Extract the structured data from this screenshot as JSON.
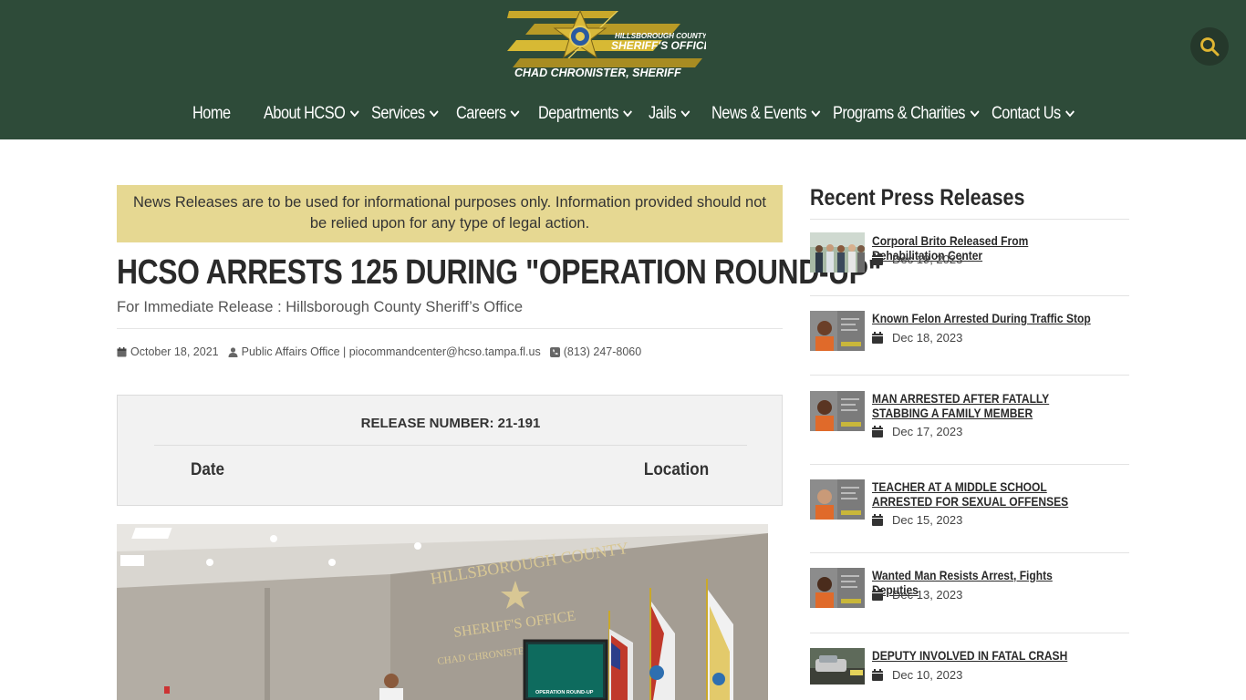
{
  "header": {
    "logo": {
      "line1": "HILLSBOROUGH COUNTY",
      "line2": "SHERIFF'S OFFICE",
      "line3": "CHAD CHRONISTER, SHERIFF"
    },
    "search_icon": "search-icon",
    "nav": [
      {
        "label": "Home",
        "has_dropdown": false
      },
      {
        "label": "About HCSO",
        "has_dropdown": true
      },
      {
        "label": "Services",
        "has_dropdown": true
      },
      {
        "label": "Careers",
        "has_dropdown": true
      },
      {
        "label": "Departments",
        "has_dropdown": true
      },
      {
        "label": "Jails",
        "has_dropdown": true
      },
      {
        "label": "News & Events",
        "has_dropdown": true
      },
      {
        "label": "Programs & Charities",
        "has_dropdown": true
      },
      {
        "label": "Contact Us",
        "has_dropdown": true
      }
    ]
  },
  "article": {
    "notice": "News Releases are to be used for informational purposes only. Information provided should not be relied upon for any type of legal action.",
    "title": "HCSO ARRESTS 125 DURING \"OPERATION ROUND-UP\"",
    "subtitle": "For Immediate Release : Hillsborough County Sheriff’s Office",
    "meta": {
      "date": "October 18, 2021",
      "author": "Public Affairs Office | piocommandcenter@hcso.tampa.fl.us",
      "phone": "(813) 247-8060"
    },
    "release_box": {
      "release_number": "RELEASE NUMBER: 21-191",
      "col_date": "Date",
      "col_location": "Location"
    },
    "photo": {
      "wall_line1": "HILLSBOROUGH COUNTY",
      "wall_line2": "SHERIFF'S OFFICE",
      "wall_line3": "CHAD CHRONISTER, SHERIFF",
      "screen_text": "OPERATION ROUND-UP"
    }
  },
  "sidebar": {
    "title": "Recent Press Releases",
    "items": [
      {
        "title": "Corporal Brito Released From Rehabilitation Center",
        "date": "Dec 19, 2023",
        "thumb": "group-photo"
      },
      {
        "title": "Known Felon Arrested During Traffic Stop",
        "date": "Dec 18, 2023",
        "thumb": "mugshot"
      },
      {
        "title": "MAN ARRESTED AFTER FATALLY STABBING A FAMILY MEMBER",
        "date": "Dec 17, 2023",
        "thumb": "mugshot"
      },
      {
        "title": "TEACHER AT A MIDDLE SCHOOL ARRESTED FOR SEXUAL OFFENSES",
        "date": "Dec 15, 2023",
        "thumb": "mugshot"
      },
      {
        "title": "Wanted Man Resists Arrest, Fights Deputies",
        "date": "Dec 13, 2023",
        "thumb": "mugshot"
      },
      {
        "title": "DEPUTY INVOLVED IN FATAL CRASH",
        "date": "Dec 10, 2023",
        "thumb": "crash-photo"
      }
    ]
  },
  "colors": {
    "header_bg": "#2e4b39",
    "gold": "#d4b22a",
    "notice_bg": "#e6d892"
  }
}
